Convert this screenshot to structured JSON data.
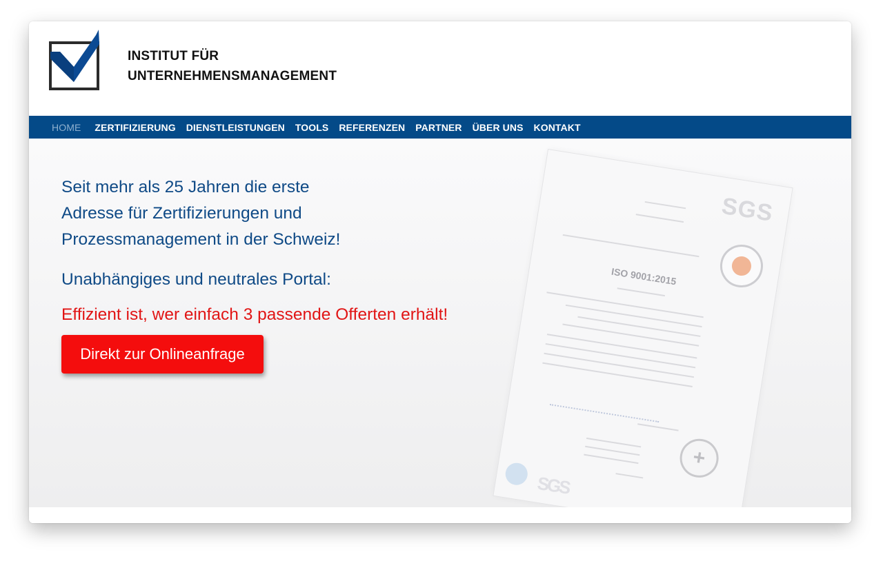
{
  "brand": {
    "line1": "INSTITUT FÜR",
    "line2": "UNTERNEHMENSMANAGEMENT"
  },
  "nav": {
    "items": [
      "HOME",
      "ZERTIFIZIERUNG",
      "DIENSTLEISTUNGEN",
      "TOOLS",
      "REFERENZEN",
      "PARTNER",
      "ÜBER UNS",
      "KONTAKT"
    ],
    "active": "HOME"
  },
  "hero": {
    "headline": [
      "Seit mehr als 25 Jahren die erste",
      "Adresse für Zertifizierungen und",
      "Prozessmanagement in der Schweiz!"
    ],
    "subhead": "Unabhängiges und neutrales Portal:",
    "tagline": "Effizient ist, wer einfach 3 passende Offerten erhält!",
    "cta_label": "Direkt zur Onlineanfrage"
  },
  "certificate": {
    "issuer_logo": "SGS",
    "standard": "ISO 9001:2015",
    "footer_mark": "SGS"
  },
  "colors": {
    "nav_bg": "#044a88",
    "headline": "#0f4a86",
    "tagline": "#e11515",
    "cta_bg": "#f40d0d"
  }
}
